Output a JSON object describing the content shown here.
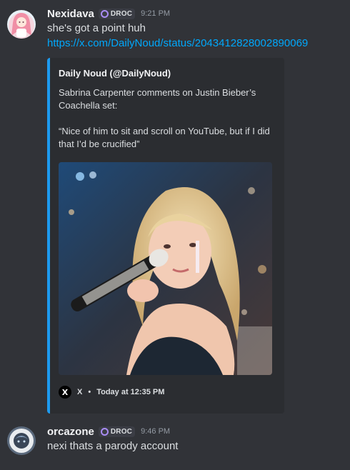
{
  "messages": [
    {
      "username": "Nexidava",
      "tag": "DROC",
      "timestamp": "9:21 PM",
      "text": "she's got a point huh",
      "link": "https://x.com/DailyNoud/status/2043412828002890069",
      "embed": {
        "author": "Daily Noud (@DailyNoud)",
        "description": [
          "Sabrina Carpenter comments on Justin Bieber’s Coachella set:",
          "“Nice of him to sit and scroll on YouTube, but if I did that I’d be crucified”"
        ],
        "footer_source": "X",
        "footer_time": "Today at 12:35 PM",
        "accent_color": "#1d9bf0"
      }
    },
    {
      "username": "orcazone",
      "tag": "DROC",
      "timestamp": "9:46 PM",
      "text": "nexi thats a parody account"
    }
  ],
  "colors": {
    "background": "#313338",
    "embed_background": "#2b2d31",
    "link": "#00a8fc",
    "tag_icon": "#a98cf5"
  },
  "icons": {
    "tag_icon": "droc-badge-icon",
    "embed_source_icon": "x-logo-icon"
  }
}
